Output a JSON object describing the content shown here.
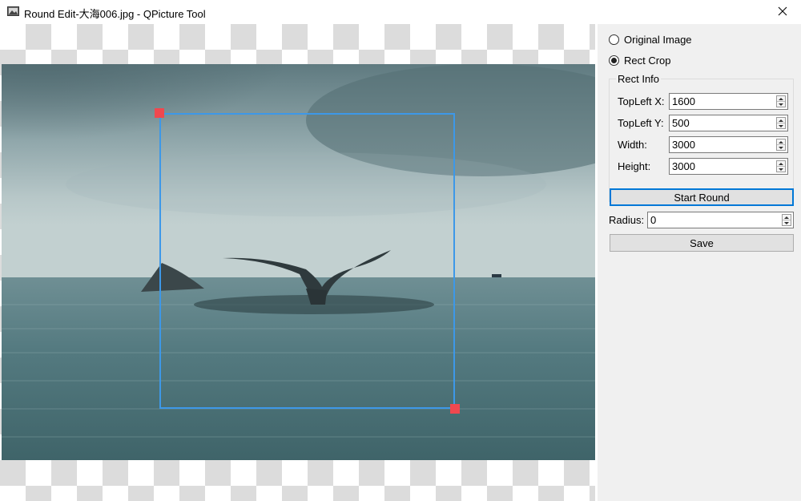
{
  "window": {
    "title": "Round Edit-大海006.jpg - QPicture Tool",
    "icons": {
      "app": "picture-icon",
      "close": "close-icon"
    }
  },
  "canvas": {
    "image_description_alt": "",
    "crop_rect": {
      "selected": true
    }
  },
  "panel": {
    "mode_options": [
      {
        "label": "Original Image",
        "checked": false
      },
      {
        "label": "Rect Crop",
        "checked": true
      }
    ],
    "rect_info": {
      "title": "Rect Info",
      "fields": [
        {
          "label": "TopLeft X:",
          "value": "1600"
        },
        {
          "label": "TopLeft Y:",
          "value": "500"
        },
        {
          "label": "Width:",
          "value": "3000"
        },
        {
          "label": "Height:",
          "value": "3000"
        }
      ]
    },
    "start_round_label": "Start Round",
    "radius": {
      "label": "Radius:",
      "value": "0"
    },
    "save_label": "Save"
  },
  "colors": {
    "crop_border": "#3d98e8",
    "crop_handle": "#f0484f",
    "focus_accent": "#0078d7"
  }
}
